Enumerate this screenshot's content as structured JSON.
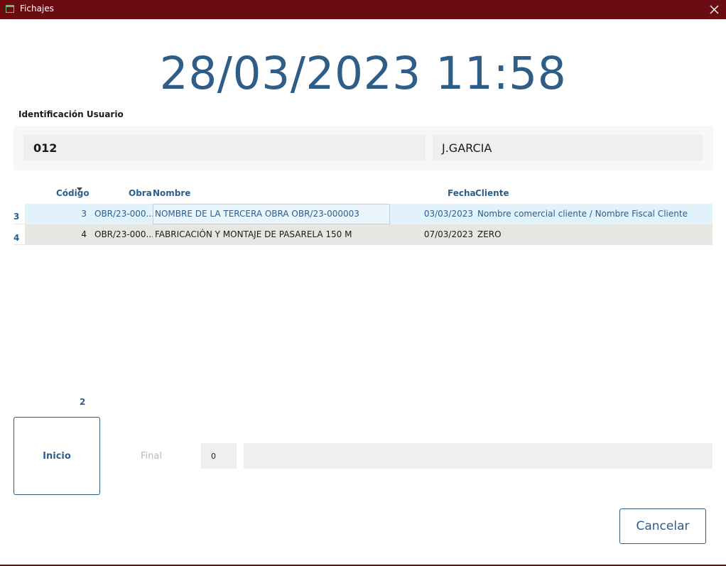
{
  "window": {
    "title": "Fichajes"
  },
  "clock": {
    "datetime": "28/03/2023 11:58"
  },
  "identification": {
    "label": "Identificación Usuario",
    "code": "012",
    "name": "J.GARCIA"
  },
  "grid": {
    "headers": {
      "codigo": "Código",
      "obra": "Obra",
      "nombre": "Nombre",
      "fecha": "Fecha",
      "cliente": "Cliente"
    },
    "rows": [
      {
        "indicator": "3",
        "codigo": "3",
        "obra": "OBR/23-000...",
        "nombre": "NOMBRE DE LA TERCERA OBRA OBR/23-000003",
        "fecha": "03/03/2023",
        "cliente": "Nombre comercial cliente / Nombre Fiscal Cliente"
      },
      {
        "indicator": "4",
        "codigo": "4",
        "obra": "OBR/23-000...",
        "nombre": "FABRICACIÓN Y MONTAJE DE PASARELA 150 M",
        "fecha": "07/03/2023",
        "cliente": "ZERO"
      }
    ],
    "count": "2"
  },
  "actions": {
    "inicio_label": "Inicio",
    "final_label": "Final",
    "final_value": "0",
    "cancel_label": "Cancelar"
  },
  "colors": {
    "titlebar": "#6b0c13",
    "accent": "#2e5e87",
    "selected_row": "#e1f2fb"
  }
}
